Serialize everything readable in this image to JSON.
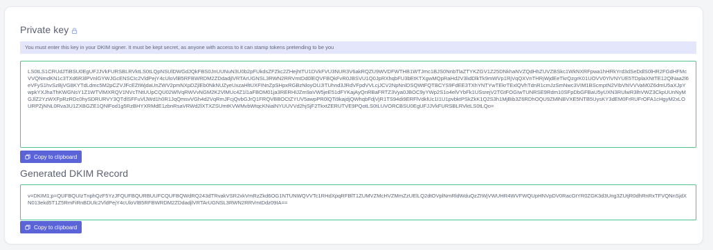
{
  "private_key": {
    "title": "Private key",
    "title_icon": "lock-icon",
    "notice": "You must enter this key in your DKIM signer. It must be kept secret, as anyone with access to it can stamp tokens pretending to be you",
    "value": "LS0tLS1CRUdJTiBSU0EgUFJJVkFURSBLRVktLS0tLQpNSUlDWGdJQkFBS0JnUUNuN3U0b2pFUkdsZFZkc2ZHejhtTU1DVkFVU3NUR3V6akRQZU9WVDFWTHB1WTJmc1BJS0NnbTlaZTYKZGV1Z25DNkhaNVZQdHhZUVZBSkc1WkNXRFpwa1hHRkYrd3dSeDdlS0lHR2FGdHFMcVVQNmdKN1c3TXd6R3lPVnlGYWJGcENSCIc2VldPejY4cUloVlB5RFBWRDM2ZDdadjlVRTArUGNSL3RWN2RRVmtDd0lEQVFBQkFvR0JBSVU1Q0JpRXhqbFU3bEtKTXgwMQpRaHd2V3lidDlkTk9mWVp1RjVqQXVnTHRjWjdEeTkrQzgrK01UOVV0YlVNYUE5TDplaXNtTE12QlNaa2l6eVFyS1hvSzBjVG8KYTdLdmc5M2pCZVJFcEZIWjdaUnZWV2pmNXpDZjlEb0NkNUZyeUxzaHltUXFINnZpSHpxRGBzNloyOUJITUhnd3JRdVFpdVVLcjJCV2NpNnlDSQWtFQTBCYS9FdEE3TXhYNTYwTEkrTExlQVhTdnR1cmJzSmNwc3VIM1BScmptN2VIbVhIVVVaM0Z6dmU5aXJpYwpkYXJhaThKWGNsY1Z1WTVlMXRQV1NVcTNtUUpCQU02WlVqRWVvNGM2K2VlMUc4Z1l1aFBOM01ja3RERHlJZm9aVW5jeE51dFYKajAyQnRBaFRTZ3Vya0JBOC9yYWp2S1o4elVYbFk1USsrejV2TGtFOGIwTUNRSE9Rdm10SFpDbGFBaU5yUXN3RUlwR3lhVWZ3CkpUUnNyMGJlZ2YzWXFpRzRDc0hySDRURVY3QTdlSFFuVlJWd1h0R1JqQmsvVGh4d2VqRmJFcjQvbGJrQ1FRQVBBOCtZYUV5awpPR0lQTi9kajdjQWhqbFdjVjR1TS94di9ERFlVdklUc1I1U1pvbktPSkZkK1Q2S3h1MjBib3Z6RDhOQU9ZMlNBVXE5NTB5UysKY3dEM0FrRUFrOFA1cHgyM2xLOURPZjNNL0Rva3U1ZXBGZE1QNlFod1g5RzBHYXRMdE1zbnRsaVRWd2lXTXZSUmtKVWMvbWtqcKNialNYUUVVd2hjSjF2TkxtZERUTVE9PQotLS0tLUVORCBSU0EgUFJJVkFURSBLRVktLS0tLQo="
  },
  "dkim_record": {
    "title": "Generated DKIM Record",
    "value": "v=DKIM1;p=QUFBQUIzTnphQzF5YzJFQUFBQURBUUFCQUFBQWdRQ243dTRvakVSR2xkVmRzZkd6OG1NTUNWQVVTc1RHdXpqRFBlT1ZUMVZMcHVZMmZzUElLQ2dtOVplNmRldWduQzZIWjVWUHR4WVFWQUpHNVpDV0RacGtYR0ZGK3d3Ung3ZUtjR0dhRnRxTFVQNnSjdXN013ekd5T1Z5RmFiRnBDUlc2VldPejY4cUloVlB5RFBWRDM2ZDdadjlVRTArUGNSL3RWN2RRVmtDdz09IA=="
  },
  "buttons": {
    "copy_label": "Copy to clipboard",
    "copy_icon": "copy-icon"
  },
  "colors": {
    "accent": "#5b63d8",
    "border_green": "#4fc38a",
    "notice_bg": "#e4e7fb"
  }
}
